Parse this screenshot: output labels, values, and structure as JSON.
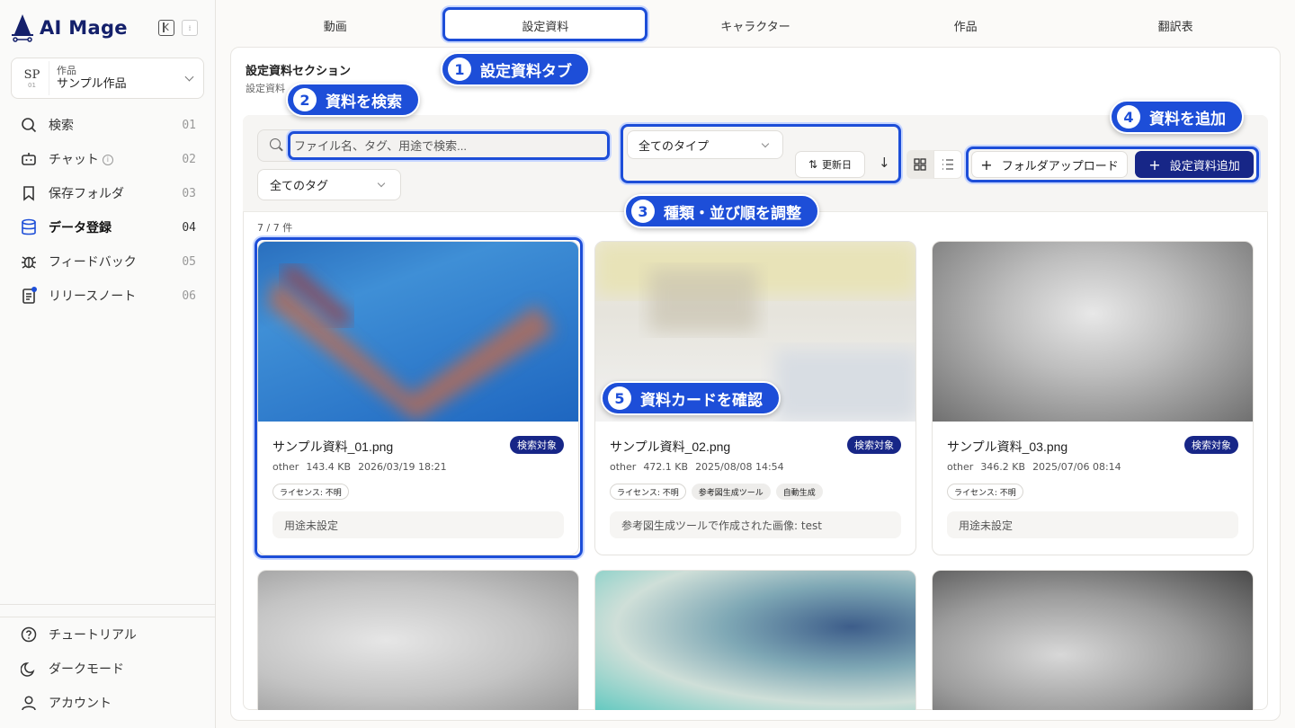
{
  "app": {
    "name": "AI Mage"
  },
  "project": {
    "avatar": "SP",
    "avatar_num": "01",
    "label": "作品",
    "name": "サンプル作品"
  },
  "nav": [
    {
      "label": "検索",
      "num": "01",
      "icon": "search-icon"
    },
    {
      "label": "チャット",
      "num": "02",
      "icon": "bot-icon"
    },
    {
      "label": "保存フォルダ",
      "num": "03",
      "icon": "bookmark-icon"
    },
    {
      "label": "データ登録",
      "num": "04",
      "icon": "database-icon",
      "active": true
    },
    {
      "label": "フィードバック",
      "num": "05",
      "icon": "bug-icon"
    },
    {
      "label": "リリースノート",
      "num": "06",
      "icon": "notes-icon"
    }
  ],
  "bottom_nav": [
    {
      "label": "チュートリアル",
      "icon": "help-icon"
    },
    {
      "label": "ダークモード",
      "icon": "moon-icon"
    },
    {
      "label": "アカウント",
      "icon": "user-icon"
    }
  ],
  "tabs": [
    "動画",
    "設定資料",
    "キャラクター",
    "作品",
    "翻訳表"
  ],
  "active_tab": "設定資料",
  "section": {
    "title": "設定資料セクション",
    "subtitle": "設定資料"
  },
  "search": {
    "placeholder": "ファイル名、タグ、用途で検索..."
  },
  "filters": {
    "tag": "全てのタグ",
    "type": "全てのタイプ",
    "sort": "更新日",
    "sort_dir": "↓"
  },
  "actions": {
    "upload": "フォルダアップロード",
    "add": "設定資料追加"
  },
  "count": "7 / 7 件",
  "cards": [
    {
      "title": "サンプル資料_01.png",
      "badge": "検索対象",
      "type": "other",
      "size": "143.4 KB",
      "date": "2026/03/19 18:21",
      "tags": [
        "ライセンス: 不明"
      ],
      "use": "用途未設定"
    },
    {
      "title": "サンプル資料_02.png",
      "badge": "検索対象",
      "type": "other",
      "size": "472.1 KB",
      "date": "2025/08/08 14:54",
      "tags": [
        "ライセンス: 不明",
        "参考図生成ツール",
        "自動生成"
      ],
      "use": "参考図生成ツールで作成された画像: test"
    },
    {
      "title": "サンプル資料_03.png",
      "badge": "検索対象",
      "type": "other",
      "size": "346.2 KB",
      "date": "2025/07/06 08:14",
      "tags": [
        "ライセンス: 不明"
      ],
      "use": "用途未設定"
    }
  ],
  "callouts": [
    {
      "n": "1",
      "text": "設定資料タブ"
    },
    {
      "n": "2",
      "text": "資料を検索"
    },
    {
      "n": "3",
      "text": "種類・並び順を調整"
    },
    {
      "n": "4",
      "text": "資料を追加"
    },
    {
      "n": "5",
      "text": "資料カードを確認"
    }
  ],
  "colors": {
    "accent": "#1d4ed8",
    "brand": "#172687"
  }
}
